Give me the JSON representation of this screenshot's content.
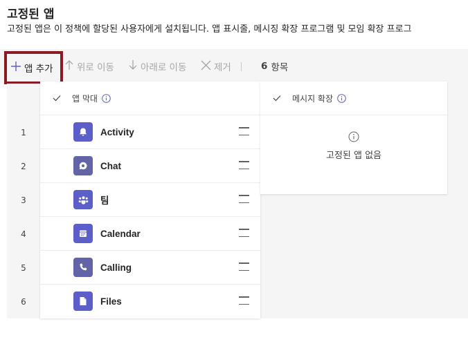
{
  "page": {
    "title": "고정된 앱",
    "description": "고정된 앱은 이 정책에 할당된 사용자에게 설치됩니다. 앱 표시줄, 메시징 확장 프로그램 및 모임 확장 프로그"
  },
  "toolbar": {
    "add_label": "앱 추가",
    "move_up_label": "위로 이동",
    "move_down_label": "아래로 이동",
    "remove_label": "제거",
    "count_number": "6",
    "count_label": "항목"
  },
  "app_bar": {
    "header": "앱 막대",
    "rows": [
      {
        "num": "1",
        "name": "Activity",
        "icon": "bell-icon"
      },
      {
        "num": "2",
        "name": "Chat",
        "icon": "chat-icon"
      },
      {
        "num": "3",
        "name": "팀",
        "icon": "teams-icon"
      },
      {
        "num": "4",
        "name": "Calendar",
        "icon": "calendar-icon"
      },
      {
        "num": "5",
        "name": "Calling",
        "icon": "phone-icon"
      },
      {
        "num": "6",
        "name": "Files",
        "icon": "file-icon"
      }
    ]
  },
  "messaging_extensions": {
    "header": "메시지 확장",
    "empty_text": "고정된 앱 없음"
  },
  "colors": {
    "app_icon_bg": "#5b5fc7",
    "highlight_border": "#8b1a24",
    "toolbar_bg": "#f5f5f5"
  }
}
